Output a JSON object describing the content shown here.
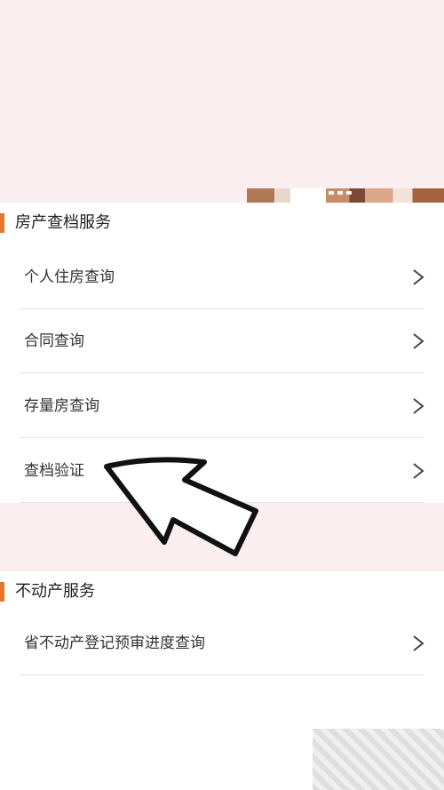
{
  "section_housing": {
    "title": "房产查档服务",
    "items": [
      {
        "label": "个人住房查询"
      },
      {
        "label": "合同查询"
      },
      {
        "label": "存量房查询"
      },
      {
        "label": "查档验证"
      }
    ]
  },
  "section_realestate": {
    "title": "不动产服务",
    "items": [
      {
        "label": "省不动产登记预审进度查询"
      }
    ]
  },
  "colors": {
    "accent": "#e8742a",
    "background_band": "#fbeef0"
  },
  "icons": {
    "row_chevron": "chevron-right-icon",
    "annotation": "pointer-arrow-icon"
  }
}
